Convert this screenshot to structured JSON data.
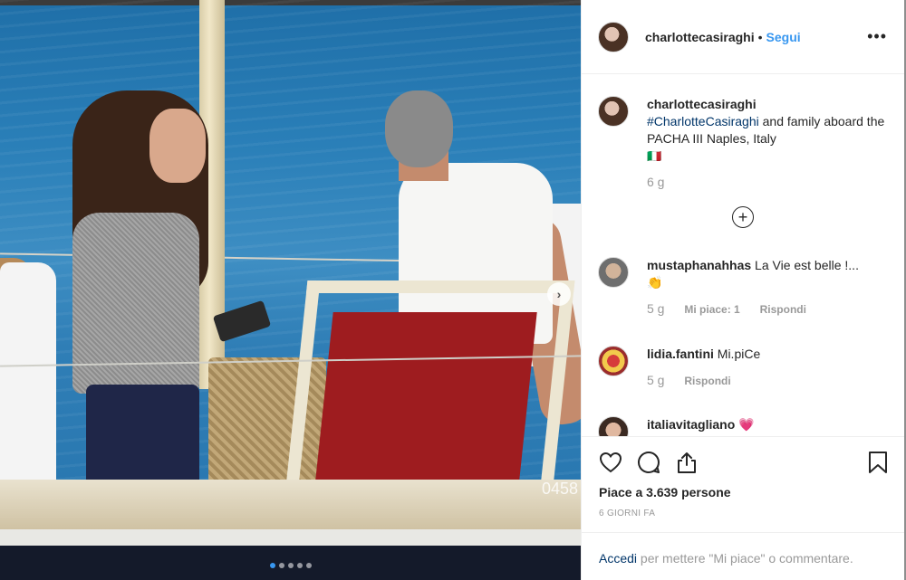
{
  "post": {
    "username": "charlottecasiraghi",
    "separator": "•",
    "follow_label": "Segui",
    "more_label": "•••"
  },
  "photo": {
    "watermark": "0458",
    "carousel_total": 5,
    "carousel_active": 1
  },
  "caption": {
    "username": "charlottecasiraghi",
    "hashtag": "#CharlotteCasiraghi",
    "text": " and family aboard the PACHA III Naples, Italy",
    "flag": "🇮🇹",
    "time": "6 g"
  },
  "comments": [
    {
      "username": "mustaphanahhas",
      "text": "La Vie est belle !...",
      "emoji": "👏",
      "time": "5 g",
      "likes": "Mi piace: 1",
      "reply": "Rispondi"
    },
    {
      "username": "lidia.fantini",
      "text": "Mi.piCe",
      "time": "5 g",
      "reply": "Rispondi"
    },
    {
      "username": "italiavitagliano",
      "text": "💗"
    }
  ],
  "actions": {
    "likes_text": "Piace a 3.639 persone",
    "date_text": "6 GIORNI FA"
  },
  "login": {
    "link": "Accedi",
    "text": " per mettere \"Mi piace\" o commentare."
  },
  "icons": [
    "heart-icon",
    "comment-icon",
    "share-icon",
    "bookmark-icon",
    "plus-icon",
    "chevron-right-icon",
    "more-icon"
  ],
  "colors": {
    "accent": "#3897f0",
    "hashtag": "#003569",
    "muted": "#999999"
  }
}
